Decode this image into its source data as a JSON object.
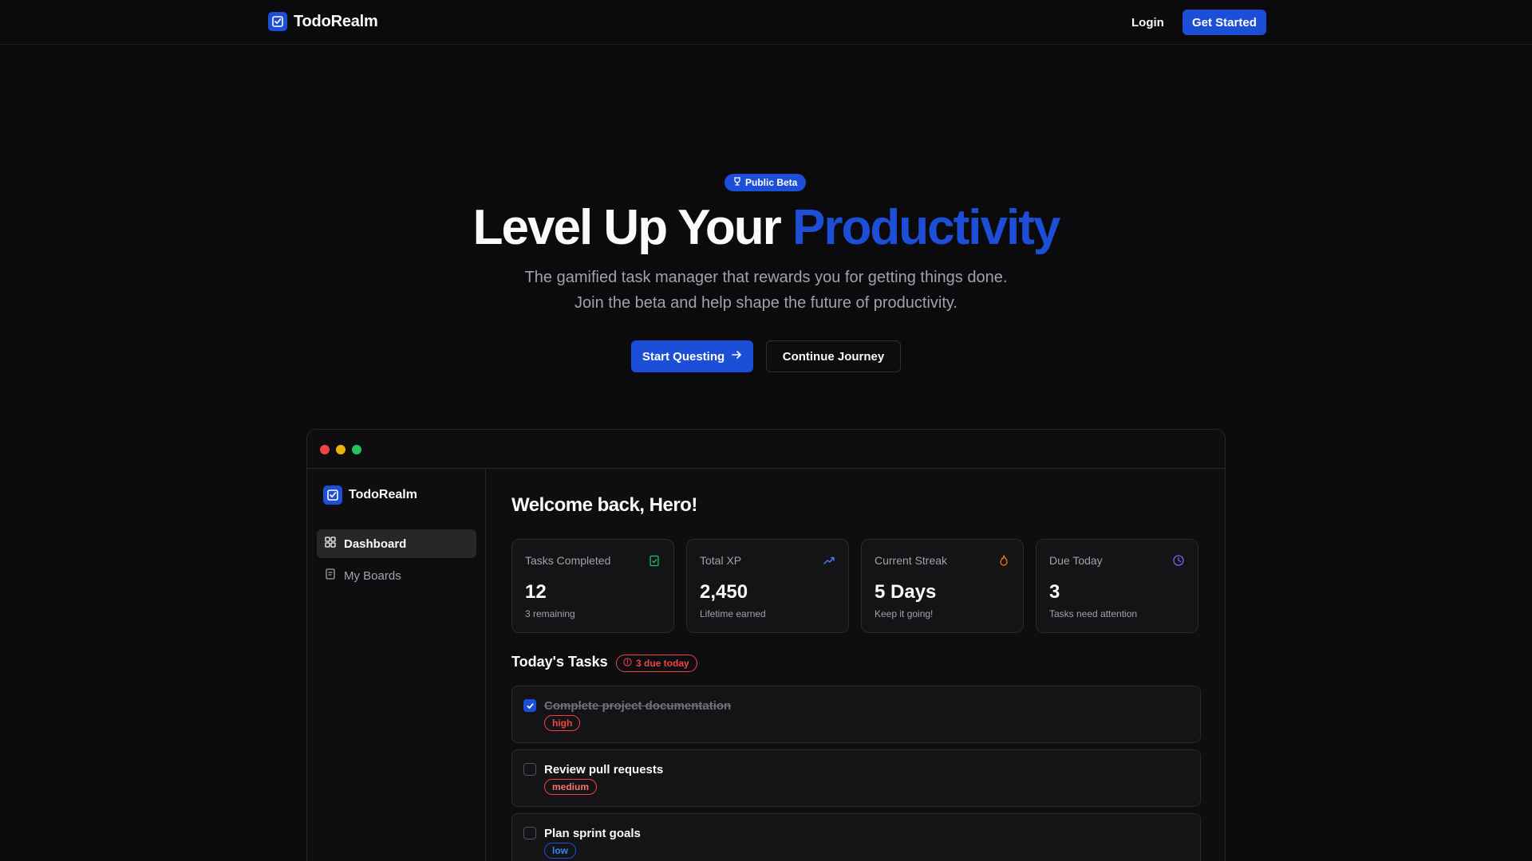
{
  "nav": {
    "brand": "TodoRealm",
    "login_label": "Login",
    "cta_label": "Get Started"
  },
  "hero": {
    "badge": "Public Beta",
    "title_plain": "Level Up Your ",
    "title_accent": "Productivity",
    "subtitle_line1": "The gamified task manager that rewards you for getting things done.",
    "subtitle_line2": "Join the beta and help shape the future of productivity.",
    "primary_cta": "Start Questing",
    "secondary_cta": "Continue Journey"
  },
  "preview": {
    "sidebar": {
      "brand": "TodoRealm",
      "items": [
        {
          "label": "Dashboard",
          "icon": "dashboard-grid-icon",
          "active": true
        },
        {
          "label": "My Boards",
          "icon": "board-icon",
          "active": false
        }
      ]
    },
    "welcome": "Welcome back, Hero!",
    "stats": [
      {
        "label": "Tasks Completed",
        "value": "12",
        "sub": "3 remaining",
        "icon": "clipboard-check-icon",
        "color": "#22c55e"
      },
      {
        "label": "Total XP",
        "value": "2,450",
        "sub": "Lifetime earned",
        "icon": "trending-up-icon",
        "color": "#3b82f6"
      },
      {
        "label": "Current Streak",
        "value": "5 Days",
        "sub": "Keep it going!",
        "icon": "flame-icon",
        "color": "#f97316"
      },
      {
        "label": "Due Today",
        "value": "3",
        "sub": "Tasks need attention",
        "icon": "clock-icon",
        "color": "#8b5cf6"
      }
    ],
    "tasks_title": "Today's Tasks",
    "due_badge": "3 due today",
    "tasks": [
      {
        "name": "Complete project documentation",
        "priority": "high",
        "done": true
      },
      {
        "name": "Review pull requests",
        "priority": "medium",
        "done": false
      },
      {
        "name": "Plan sprint goals",
        "priority": "low",
        "done": false
      }
    ]
  },
  "colors": {
    "accent": "#1d4ed8",
    "background": "#0b0b0d",
    "danger": "#ef4444"
  }
}
